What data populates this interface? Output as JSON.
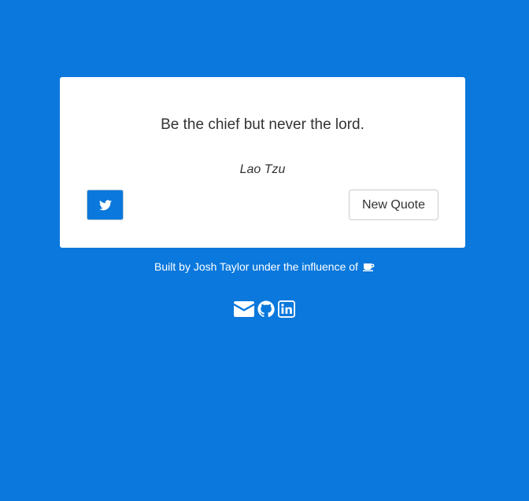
{
  "quote": {
    "text": "Be the chief but never the lord.",
    "author": "Lao Tzu"
  },
  "buttons": {
    "tweet_icon": "twitter-icon",
    "new_quote_label": "New Quote"
  },
  "footer": {
    "credit_text": "Built by Josh Taylor under the influence of",
    "credit_icon": "coffee-icon"
  },
  "social": [
    {
      "icon": "envelope-icon"
    },
    {
      "icon": "github-icon"
    },
    {
      "icon": "linkedin-icon"
    }
  ],
  "colors": {
    "background": "#0a78dc",
    "card": "#ffffff",
    "text": "#333333"
  }
}
